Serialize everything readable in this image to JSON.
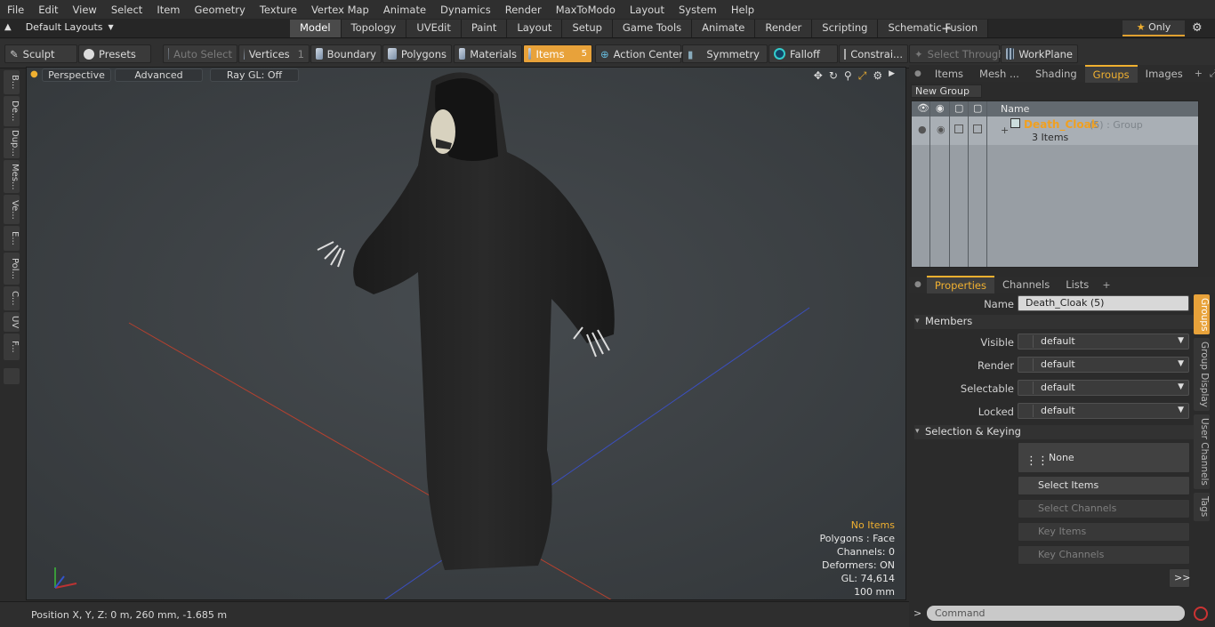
{
  "menu": [
    "File",
    "Edit",
    "View",
    "Select",
    "Item",
    "Geometry",
    "Texture",
    "Vertex Map",
    "Animate",
    "Dynamics",
    "Render",
    "MaxToModo",
    "Layout",
    "System",
    "Help"
  ],
  "layouts_label": "Default Layouts",
  "mode_tabs": [
    "Model",
    "Topology",
    "UVEdit",
    "Paint",
    "Layout",
    "Setup",
    "Game Tools",
    "Animate",
    "Render",
    "Scripting",
    "Schematic Fusion"
  ],
  "only_label": "Only",
  "toolbar": {
    "sculpt": "Sculpt",
    "presets": "Presets",
    "auto_select": "Auto Select",
    "vertices": "Vertices",
    "vertices_count": "1",
    "boundary": "Boundary",
    "polygons": "Polygons",
    "materials": "Materials",
    "items": "Items",
    "items_count": "5",
    "action_center": "Action Center",
    "symmetry": "Symmetry",
    "falloff": "Falloff",
    "constraints": "Constrai...",
    "select_through": "Select Through",
    "workplane": "WorkPlane"
  },
  "left_tabs": [
    "B...",
    "De...",
    "Dup...",
    "Mes...",
    "Ve...",
    "E...",
    "Pol...",
    "C...",
    "UV",
    "F..."
  ],
  "viewport": {
    "perspective": "Perspective",
    "advanced": "Advanced",
    "raygl": "Ray GL: Off",
    "stats": {
      "no_items": "No Items",
      "polygons": "Polygons : Face",
      "channels": "Channels: 0",
      "deformers": "Deformers: ON",
      "gl": "GL: 74,614",
      "scale": "100 mm"
    }
  },
  "status": "Position X, Y, Z:   0 m, 260 mm, -1.685 m",
  "right_tabs": [
    "Items",
    "Mesh ...",
    "Shading",
    "Groups",
    "Images"
  ],
  "groups": {
    "new_group": "New Group",
    "name_header": "Name",
    "group_name": "Death_Cloak",
    "group_suffix": "(5) : Group",
    "group_count": "3 Items"
  },
  "prop_tabs": [
    "Properties",
    "Channels",
    "Lists"
  ],
  "properties": {
    "name_label": "Name",
    "name_value": "Death_Cloak (5)",
    "members_section": "Members",
    "visible_label": "Visible",
    "visible_value": "default",
    "render_label": "Render",
    "render_value": "default",
    "selectable_label": "Selectable",
    "selectable_value": "default",
    "locked_label": "Locked",
    "locked_value": "default",
    "keying_section": "Selection & Keying",
    "none_btn": "None",
    "select_items": "Select Items",
    "select_channels": "Select Channels",
    "key_items": "Key Items",
    "key_channels": "Key Channels",
    "more": ">>"
  },
  "side_tabs": [
    "Groups",
    "Group Display",
    "User Channels",
    "Tags"
  ],
  "command_placeholder": "Command"
}
